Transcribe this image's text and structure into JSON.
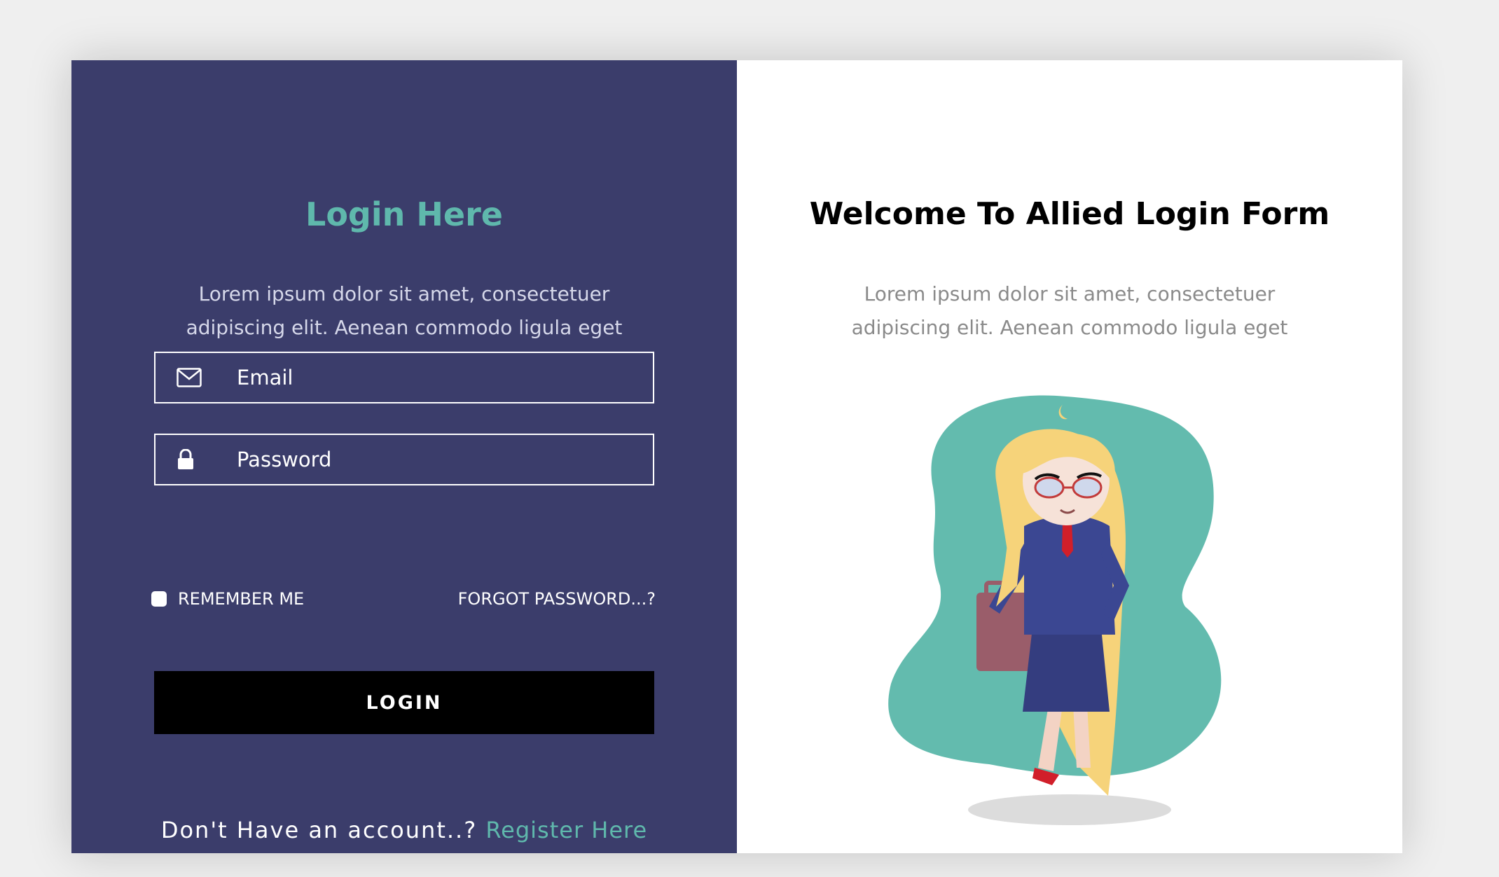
{
  "colors": {
    "left_panel": "#3b3d6b",
    "accent": "#5fb8ac",
    "right_panel": "#ffffff",
    "button": "#000000",
    "left_text": "#d6d8ea",
    "right_text": "#8a8a8a"
  },
  "login": {
    "title": "Login Here",
    "description": "Lorem ipsum dolor sit amet, consectetuer adipiscing elit. Aenean commodo ligula eget",
    "email": {
      "placeholder": "Email",
      "value": "",
      "icon": "envelope-icon"
    },
    "password": {
      "placeholder": "Password",
      "value": "",
      "icon": "lock-icon"
    },
    "remember_label": "REMEMBER ME",
    "remember_checked": false,
    "forgot_label": "FORGOT PASSWORD...?",
    "button_label": "LOGIN",
    "register_prompt": "Don't Have an account..?",
    "register_link": "Register Here"
  },
  "welcome": {
    "title": "Welcome To Allied Login Form",
    "description": "Lorem ipsum dolor sit amet, consectetuer adipiscing elit. Aenean commodo ligula eget",
    "illustration": "businesswoman-with-briefcase-illustration"
  }
}
